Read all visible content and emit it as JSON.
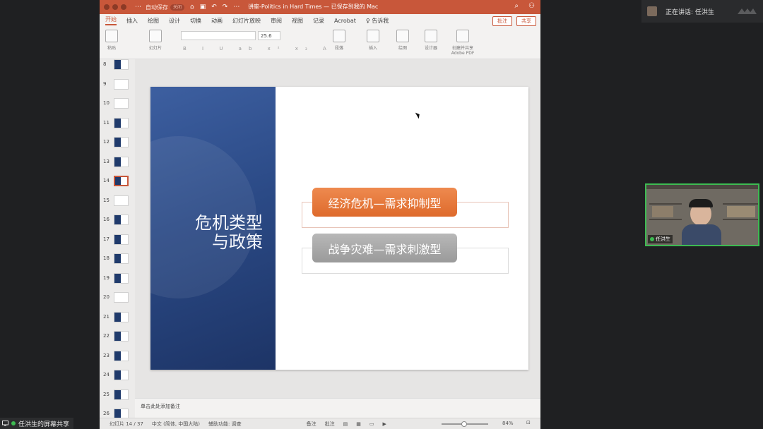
{
  "meeting": {
    "speaker_label": "正在讲话: 任洪生",
    "camera_name": "任洪生",
    "share_label": "任洪生的屏幕共享"
  },
  "window": {
    "autosave_label": "自动保存",
    "autosave_state": "关闭",
    "title": "讲座-Politics in Hard Times — 已保存到我的 Mac"
  },
  "tabs": [
    "开始",
    "插入",
    "绘图",
    "设计",
    "切换",
    "动画",
    "幻灯片放映",
    "审阅",
    "视图",
    "记录",
    "Acrobat"
  ],
  "tell_me": "告诉我",
  "comment_button": "批注",
  "share_button": "共享",
  "ribbon": {
    "paste": "粘贴",
    "slides": "幻灯片",
    "font_size": "25.6",
    "paragraph": "段落",
    "insert": "插入",
    "drawing": "绘图",
    "designer": "设计器",
    "adobe": "创建并共享 Adobe PDF"
  },
  "thumbnails": [
    "8",
    "9",
    "10",
    "11",
    "12",
    "13",
    "14",
    "15",
    "16",
    "17",
    "18",
    "19",
    "20",
    "21",
    "22",
    "23",
    "24",
    "25",
    "26"
  ],
  "selected_slide": "14",
  "slide": {
    "title_line1": "危机类型",
    "title_line2": "与政策",
    "item1": "经济危机—需求抑制型",
    "item2": "战争灾难—需求刺激型"
  },
  "notes_placeholder": "单击此处添加备注",
  "status": {
    "slide_counter": "幻灯片 14 / 37",
    "language": "中文 (简体, 中国大陆)",
    "accessibility": "辅助功能: 调查",
    "notes": "备注",
    "comments": "批注",
    "zoom": "84%"
  },
  "colors": {
    "accent": "#c8573a",
    "slide_blue": "#2b4a86",
    "pill_orange": "#e5733a",
    "pill_grey": "#a6a6a6",
    "active_speaker": "#3dbb52"
  }
}
